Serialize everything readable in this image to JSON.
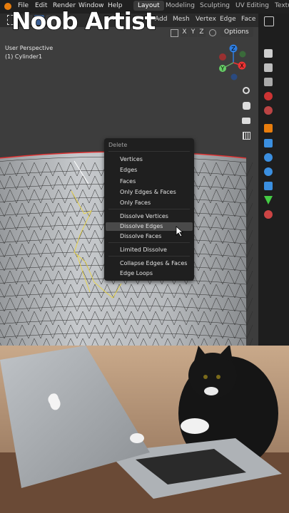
{
  "overlay_title": "Noob Artist",
  "topbar": {
    "menus": [
      "File",
      "Edit",
      "Render",
      "Window",
      "Help"
    ],
    "workspaces": [
      "Layout",
      "Modeling",
      "Sculpting",
      "UV Editing",
      "Textu"
    ],
    "active_workspace": "Layout"
  },
  "header": {
    "menus": [
      "Add",
      "Mesh",
      "Vertex",
      "Edge",
      "Face"
    ],
    "axes": [
      "X",
      "Y",
      "Z"
    ],
    "options_label": "Options"
  },
  "viewport": {
    "perspective": "User Perspective",
    "object": "(1) Cylinder1"
  },
  "gizmo": {
    "x": "X",
    "y": "Y",
    "z": "Z"
  },
  "delete_menu": {
    "title": "Delete",
    "items": [
      "Vertices",
      "Edges",
      "Faces",
      "Only Edges & Faces",
      "Only Faces",
      "Dissolve Vertices",
      "Dissolve Edges",
      "Dissolve Faces",
      "Limited Dissolve",
      "Collapse Edges & Faces",
      "Edge Loops"
    ],
    "highlighted": "Dissolve Edges"
  },
  "colors": {
    "menu_bg": "#1f1f1f",
    "highlight": "#4a4a4a",
    "selected_edges": "#e8d44d",
    "mesh": "#b9bcbf"
  }
}
